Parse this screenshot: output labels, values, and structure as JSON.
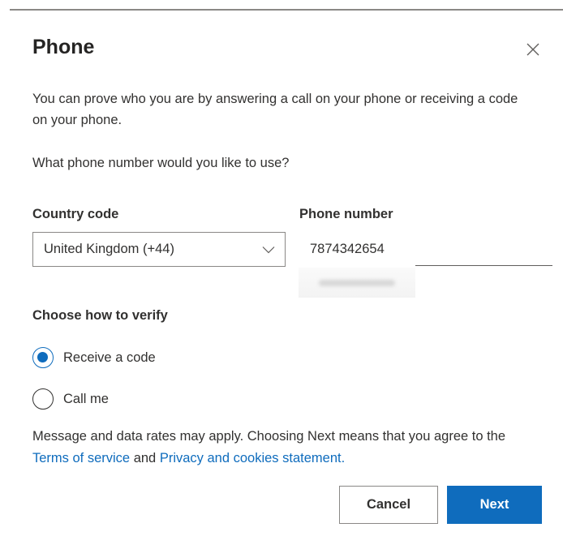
{
  "dialog": {
    "title": "Phone",
    "close_icon": "close-icon",
    "intro_text": "You can prove who you are by answering a call on your phone or receiving a code on your phone.",
    "question": "What phone number would you like to use?"
  },
  "form": {
    "country_code": {
      "label": "Country code",
      "selected": "United Kingdom (+44)",
      "icon": "chevron-down-icon"
    },
    "phone_number": {
      "label": "Phone number",
      "value": "7874342654"
    }
  },
  "verify": {
    "heading": "Choose how to verify",
    "options": [
      {
        "label": "Receive a code",
        "checked": true
      },
      {
        "label": "Call me",
        "checked": false
      }
    ]
  },
  "disclaimer": {
    "text_before": "Message and data rates may apply. Choosing Next means that you agree to the ",
    "terms_link": "Terms of service",
    "text_middle": " and ",
    "privacy_link": "Privacy and cookies statement.",
    "link_color": "#0f6cbd"
  },
  "buttons": {
    "cancel": "Cancel",
    "next": "Next",
    "primary_color": "#0f6cbd"
  }
}
